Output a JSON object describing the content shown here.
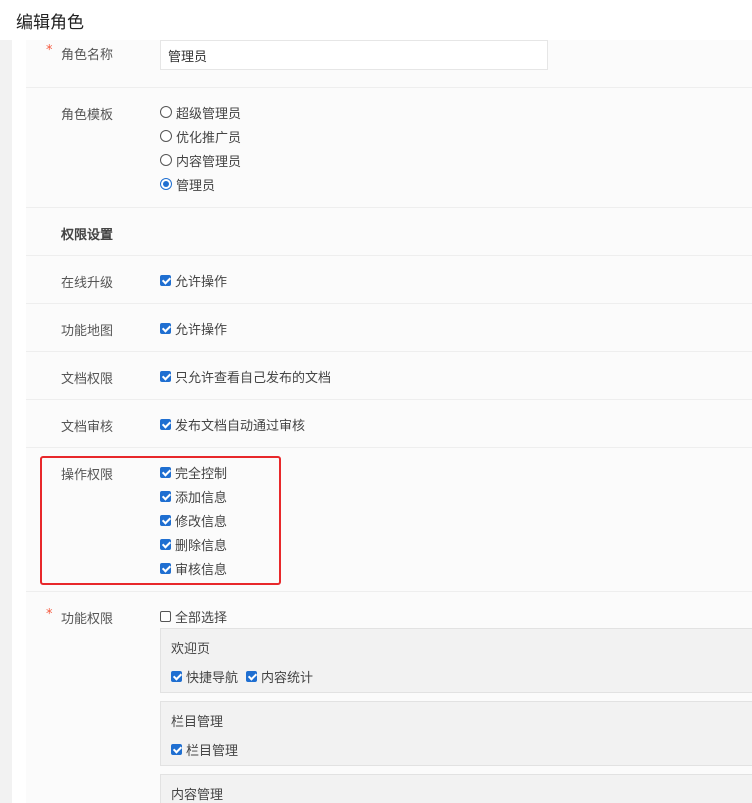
{
  "page": {
    "title": "编辑角色"
  },
  "form": {
    "required_mark": "*",
    "role_name": {
      "label": "角色名称",
      "value": "管理员"
    },
    "role_template": {
      "label": "角色模板",
      "options": [
        {
          "label": "超级管理员",
          "selected": false
        },
        {
          "label": "优化推广员",
          "selected": false
        },
        {
          "label": "内容管理员",
          "selected": false
        },
        {
          "label": "管理员",
          "selected": true
        }
      ]
    },
    "permission_section": {
      "label": "权限设置"
    },
    "online_upgrade": {
      "label": "在线升级",
      "option": "允许操作",
      "checked": true
    },
    "site_map": {
      "label": "功能地图",
      "option": "允许操作",
      "checked": true
    },
    "doc_permission": {
      "label": "文档权限",
      "option": "只允许查看自己发布的文档",
      "checked": true
    },
    "doc_review": {
      "label": "文档审核",
      "option": "发布文档自动通过审核",
      "checked": true
    },
    "operation_permission": {
      "label": "操作权限",
      "options": [
        {
          "label": "完全控制",
          "checked": true
        },
        {
          "label": "添加信息",
          "checked": true
        },
        {
          "label": "修改信息",
          "checked": true
        },
        {
          "label": "删除信息",
          "checked": true
        },
        {
          "label": "审核信息",
          "checked": true
        }
      ]
    },
    "function_permission": {
      "label": "功能权限",
      "select_all": {
        "label": "全部选择",
        "checked": false
      },
      "groups": [
        {
          "title": "欢迎页",
          "items": [
            {
              "label": "快捷导航",
              "checked": true
            },
            {
              "label": "内容统计",
              "checked": true
            }
          ]
        },
        {
          "title": "栏目管理",
          "items": [
            {
              "label": "栏目管理",
              "checked": true
            }
          ]
        },
        {
          "title": "内容管理",
          "items": []
        }
      ]
    }
  },
  "colors": {
    "accent": "#1f6fd1",
    "required": "#f5563a",
    "highlight_border": "#e8282b"
  }
}
